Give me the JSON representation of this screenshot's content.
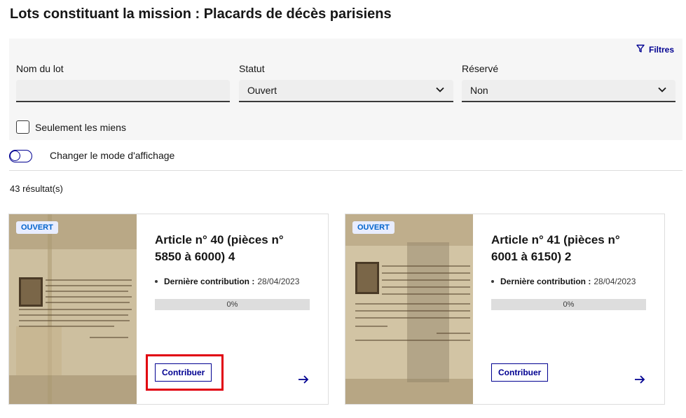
{
  "page": {
    "title": "Lots constituant la mission : Placards de décès parisiens"
  },
  "filters": {
    "toggle_label": "Filtres",
    "lot_name": {
      "label": "Nom du lot",
      "value": "",
      "placeholder": ""
    },
    "status": {
      "label": "Statut",
      "selected": "Ouvert"
    },
    "reserved": {
      "label": "Réservé",
      "selected": "Non"
    },
    "only_mine": {
      "label": "Seulement les miens",
      "checked": false
    }
  },
  "display_mode": {
    "label": "Changer le mode d'affichage",
    "on": false
  },
  "results": {
    "count_text": "43 résultat(s)",
    "cards": [
      {
        "badge": "OUVERT",
        "title": "Article n° 40 (pièces n° 5850 à 6000) 4",
        "meta_label": "Dernière contribution :",
        "meta_value": "28/04/2023",
        "progress": 0,
        "progress_text": "0%",
        "button_label": "Contribuer"
      },
      {
        "badge": "OUVERT",
        "title": "Article n° 41 (pièces n° 6001 à 6150) 2",
        "meta_label": "Dernière contribution :",
        "meta_value": "28/04/2023",
        "progress": 0,
        "progress_text": "0%",
        "button_label": "Contribuer"
      }
    ]
  },
  "colors": {
    "accent": "#000091",
    "badge_bg": "#e8edff",
    "badge_text": "#0063cb",
    "highlight": "#e1000f"
  },
  "icons": [
    "filter-icon",
    "chevron-down-icon",
    "arrow-right-icon"
  ]
}
